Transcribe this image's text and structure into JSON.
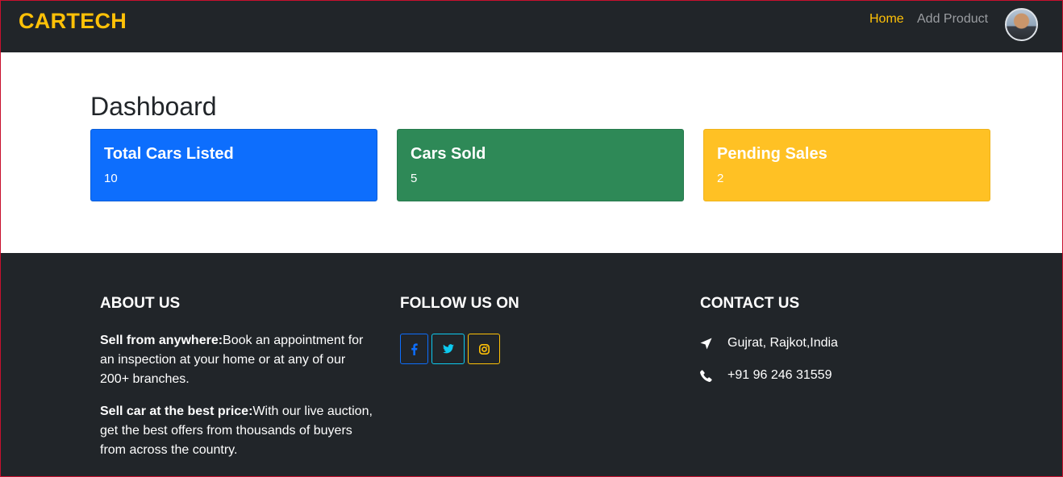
{
  "navbar": {
    "brand": "CARTECH",
    "links": [
      {
        "label": "Home",
        "active": true
      },
      {
        "label": "Add Product",
        "active": false
      }
    ],
    "avatar_icon": "user-avatar"
  },
  "dashboard": {
    "title": "Dashboard",
    "cards": [
      {
        "title": "Total Cars Listed",
        "value": "10",
        "color": "#0d6efd"
      },
      {
        "title": "Cars Sold",
        "value": "5",
        "color": "#2e8957"
      },
      {
        "title": "Pending Sales",
        "value": "2",
        "color": "#ffc124"
      }
    ]
  },
  "footer": {
    "about": {
      "heading": "ABOUT US",
      "items": [
        {
          "bold": "Sell from anywhere:",
          "text": "Book an appointment for an inspection at your home or at any of our 200+ branches."
        },
        {
          "bold": "Sell car at the best price:",
          "text": "With our live auction, get the best offers from thousands of buyers from across the country."
        }
      ]
    },
    "follow": {
      "heading": "FOLLOW US ON",
      "icons": [
        {
          "name": "facebook-icon",
          "color": "#0d6efd"
        },
        {
          "name": "twitter-icon",
          "color": "#0dcaf0"
        },
        {
          "name": "instagram-icon",
          "color": "#ffc107"
        }
      ]
    },
    "contact": {
      "heading": "CONTACT US",
      "location": "Gujrat, Rajkot,India",
      "phone": "+91 96 246 31559",
      "location_icon": "location-arrow-icon",
      "phone_icon": "phone-icon"
    }
  }
}
